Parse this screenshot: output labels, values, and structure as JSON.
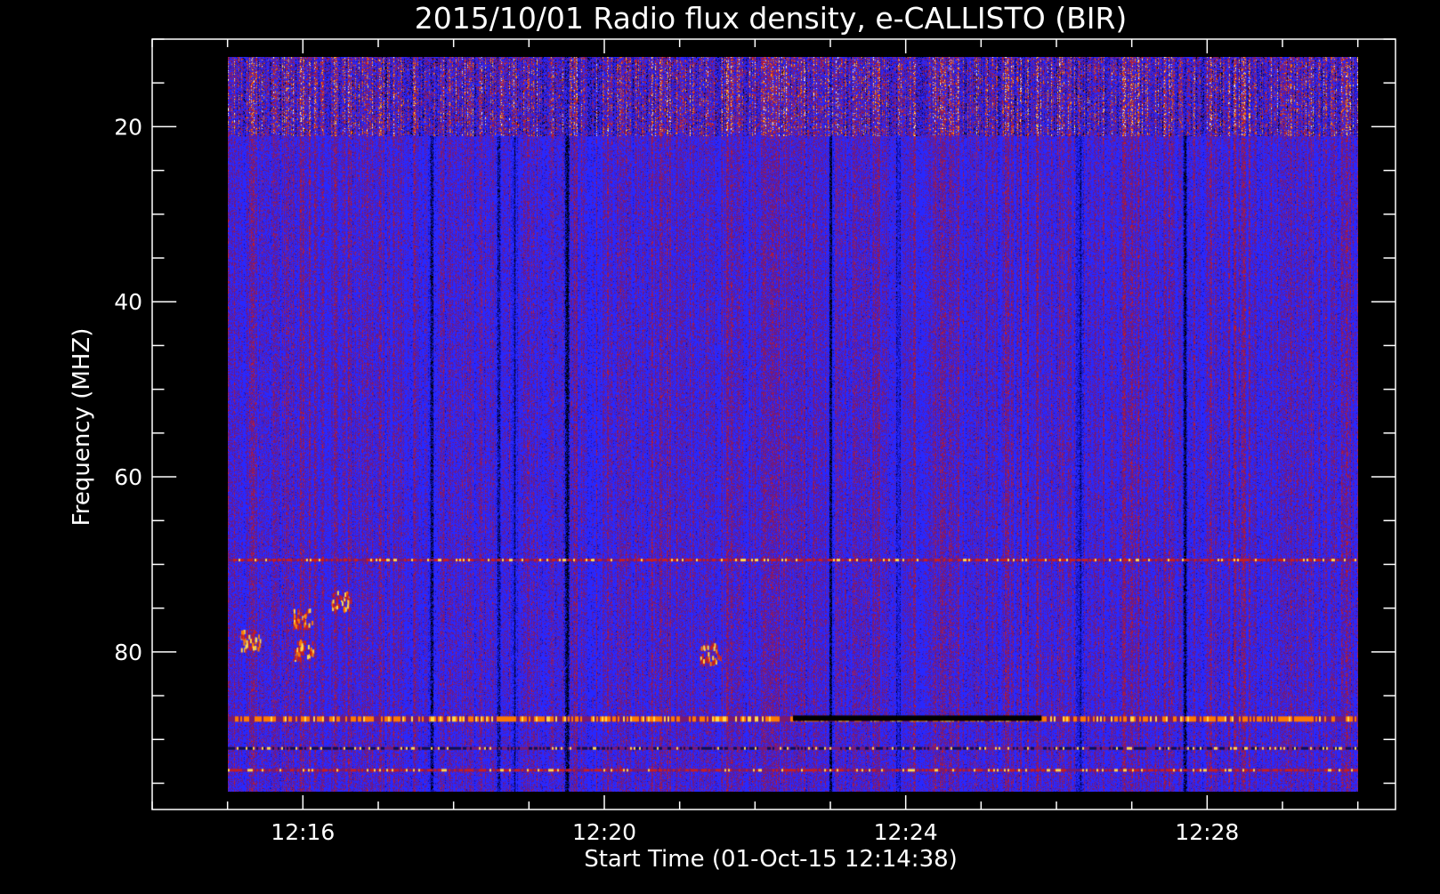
{
  "chart_data": {
    "type": "heatmap",
    "title": "2015/10/01  Radio flux density, e-CALLISTO (BIR)",
    "xlabel": "Start Time (01-Oct-15 12:14:38)",
    "ylabel": "Frequency (MHZ)",
    "x_start_min": 735.0,
    "x_end_min": 750.0,
    "x_axis_min": 734.0,
    "x_axis_max": 750.5,
    "x_major_ticks": [
      {
        "value": 736,
        "label": "12:16"
      },
      {
        "value": 740,
        "label": "12:20"
      },
      {
        "value": 744,
        "label": "12:24"
      },
      {
        "value": 748,
        "label": "12:28"
      }
    ],
    "x_minor_step": 1,
    "y_axis_min": 10,
    "y_axis_max": 98,
    "y_data_min": 12,
    "y_data_max": 96,
    "y_major_ticks": [
      {
        "value": 20,
        "label": "20"
      },
      {
        "value": 40,
        "label": "40"
      },
      {
        "value": 60,
        "label": "60"
      },
      {
        "value": 80,
        "label": "80"
      }
    ],
    "y_minor_step": 5,
    "y_reversed": true,
    "background_color": "#1a1aff",
    "colormap": [
      "#000000",
      "#1010c8",
      "#2a2aff",
      "#7a1a70",
      "#c81e1e",
      "#ff7a00",
      "#ffd84a",
      "#ffffff"
    ],
    "features": {
      "noisy_band_top": [
        12,
        21
      ],
      "horizontal_line_mhz": [
        69.5,
        87.5,
        91,
        93.5
      ],
      "dark_vertical_times_min": [
        737.7,
        738.6,
        738.8,
        739.5,
        743.0,
        743.9,
        746.3,
        747.7
      ],
      "bright_blobs": [
        {
          "t": 736.0,
          "f": 79.5
        },
        {
          "t": 736.0,
          "f": 76.0
        },
        {
          "t": 735.3,
          "f": 78.5
        },
        {
          "t": 736.5,
          "f": 74.0
        },
        {
          "t": 741.4,
          "f": 80.0
        }
      ]
    }
  }
}
